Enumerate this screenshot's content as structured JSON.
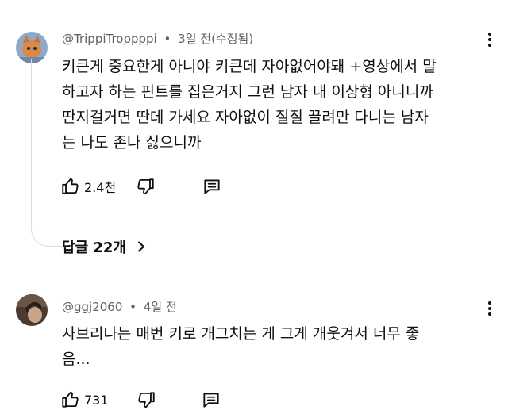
{
  "comments": [
    {
      "author": "@TrippiTroppppi",
      "time": "3일 전(수정됨)",
      "lines": [
        "키큰게 중요한게 아니야 키큰데 자아없어야돼 +영상에서 말",
        "하고자 하는 핀트를 집은거지 그런 남자 내 이상형 아니니까",
        "딴지걸거면 딴데 가세요 자아없이 질질 끌려만 다니는 남자",
        "는 나도 존나 싫으니까"
      ],
      "likes": "2.4천",
      "replies": "답글 22개"
    },
    {
      "author": "@ggj2060",
      "time": "4일 전",
      "lines": [
        "사브리나는 매번 키로 개그치는 게 그게 개웃겨서 너무 좋",
        "음..."
      ],
      "likes": "731"
    }
  ],
  "separator": "•",
  "icons": [
    "thumbs-up-icon",
    "thumbs-down-icon",
    "reply-icon",
    "more-vert-icon",
    "chevron-right-icon"
  ],
  "colors": {
    "text": "#0f0f0f",
    "meta": "#606060",
    "thread": "#dcdcdc"
  }
}
